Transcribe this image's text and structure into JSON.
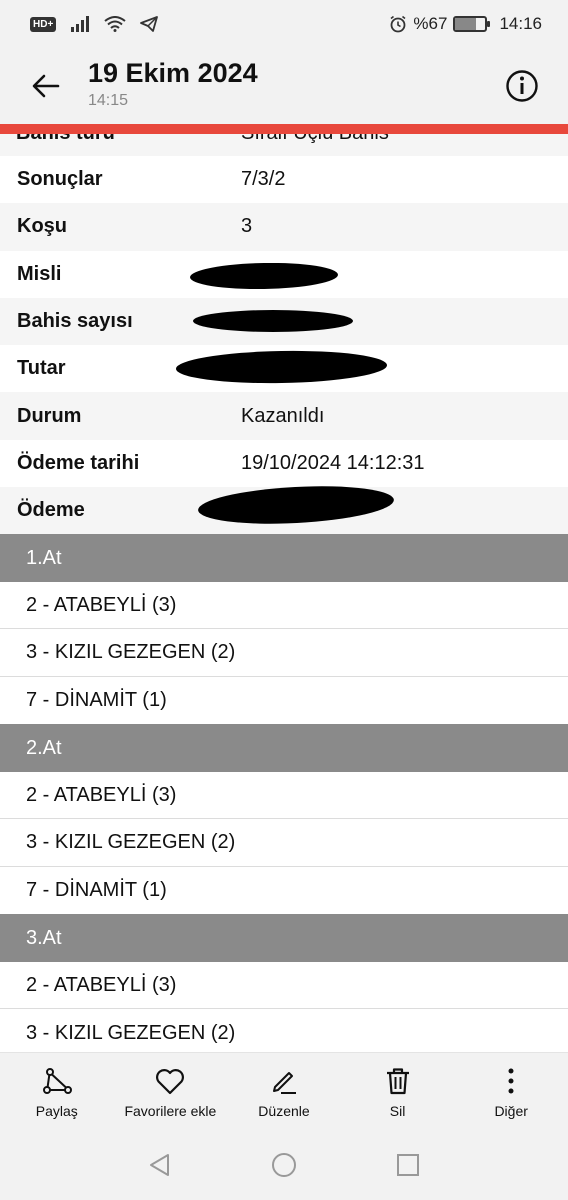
{
  "status_bar": {
    "hd_badge": "HD+",
    "battery_percent": "%67",
    "battery_level": 0.67,
    "time": "14:16",
    "icons": [
      "signal-icon",
      "wifi-icon",
      "telegram-icon",
      "alarm-icon",
      "battery-icon"
    ]
  },
  "app_bar": {
    "title": "19 Ekim 2024",
    "subtitle": "14:15",
    "back_icon": "arrow-left-icon",
    "info_icon": "info-icon"
  },
  "partial_row": {
    "label": "Bahis türü",
    "value": "Sıralı Üçlü Bahis"
  },
  "details": [
    {
      "label": "Sonuçlar",
      "value": "7/3/2"
    },
    {
      "label": "Koşu",
      "value": "3"
    },
    {
      "label": "Misli",
      "value": ""
    },
    {
      "label": "Bahis sayısı",
      "value": ""
    },
    {
      "label": "Tutar",
      "value": ""
    },
    {
      "label": "Durum",
      "value": "Kazanıldı"
    },
    {
      "label": "Ödeme tarihi",
      "value": "19/10/2024 14:12:31"
    },
    {
      "label": "Ödeme",
      "value": ""
    }
  ],
  "sections": [
    {
      "title": "1.At",
      "items": [
        "2 - ATABEYLİ (3)",
        "3 - KIZIL GEZEGEN (2)",
        "7 - DİNAMİT (1)"
      ]
    },
    {
      "title": "2.At",
      "items": [
        "2 - ATABEYLİ (3)",
        "3 - KIZIL GEZEGEN (2)",
        "7 - DİNAMİT (1)"
      ]
    },
    {
      "title": "3.At",
      "items": [
        "2 - ATABEYLİ (3)",
        "3 - KIZIL GEZEGEN (2)"
      ]
    }
  ],
  "toolbar": {
    "share_label": "Paylaş",
    "favorite_label": "Favorilere ekle",
    "edit_label": "Düzenle",
    "delete_label": "Sil",
    "more_label": "Diğer"
  },
  "colors": {
    "accent_line": "#e8483c",
    "section_header": "#8a8a8a",
    "bar_background": "#f2f2f2"
  }
}
